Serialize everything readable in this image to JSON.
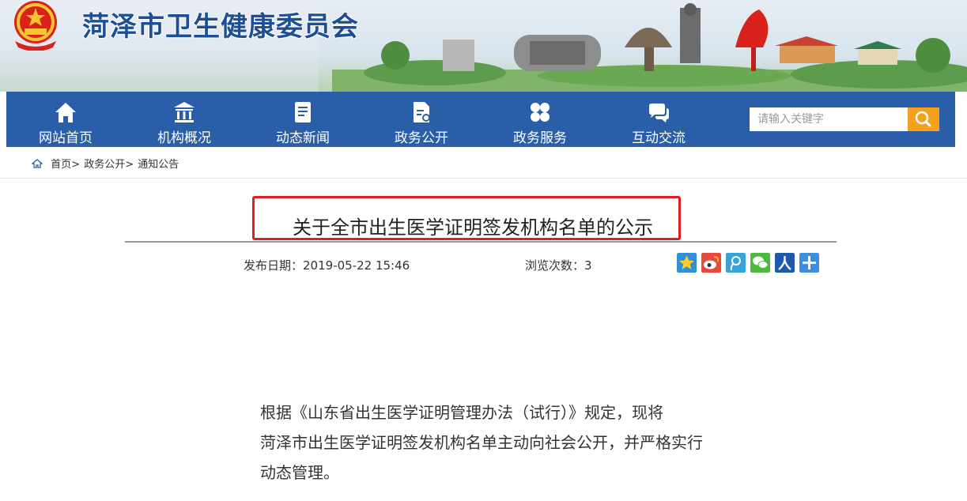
{
  "header": {
    "site_title": "菏泽市卫生健康委员会",
    "emblem_icon": "national-emblem-icon"
  },
  "nav": {
    "items": [
      {
        "label": "网站首页",
        "icon": "home-icon"
      },
      {
        "label": "机构概况",
        "icon": "institution-icon"
      },
      {
        "label": "动态新闻",
        "icon": "news-document-icon"
      },
      {
        "label": "政务公开",
        "icon": "public-document-icon"
      },
      {
        "label": "政务服务",
        "icon": "services-grid-icon"
      },
      {
        "label": "互动交流",
        "icon": "chat-bubbles-icon"
      }
    ],
    "search_placeholder": "请输入关键字",
    "search_icon": "search-icon"
  },
  "breadcrumb": {
    "items": [
      "首页>",
      "政务公开>",
      "通知公告"
    ]
  },
  "article": {
    "title": "关于全市出生医学证明签发机构名单的公示",
    "publish_date": "发布日期：2019-05-22 15:46",
    "views": "浏览次数：3",
    "share_icons": [
      "qzone-icon",
      "weibo-icon",
      "tencent-weibo-icon",
      "wechat-icon",
      "renren-icon",
      "more-share-icon"
    ],
    "body_lines": [
      "根据《山东省出生医学证明管理办法（试行）》规定，现将",
      "菏泽市出生医学证明签发机构名单主动向社会公开，并严格实行",
      "动态管理。"
    ]
  },
  "colors": {
    "nav_bg": "#2a5ea8",
    "title_blue": "#1d4f97",
    "search_button": "#f3a11d",
    "highlight_frame": "#e02020"
  }
}
